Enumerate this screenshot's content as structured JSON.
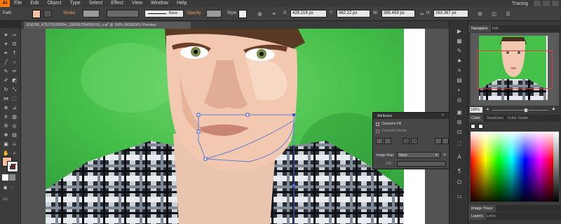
{
  "app": {
    "logo": "Ai",
    "menu": [
      "File",
      "Edit",
      "Object",
      "Type",
      "Select",
      "Effect",
      "View",
      "Window",
      "Help"
    ],
    "workspace": "Tracing"
  },
  "controlbar": {
    "selection_label": "Path",
    "stroke_label": "Stroke",
    "brush_value": "Basic",
    "opacity_label": "Opacity",
    "style_label": "Style",
    "x_value": "428.219 px",
    "y_value": "462.22 px",
    "w_value": "385.459 px",
    "h_value": "263.367 px",
    "fill_color": "#f4c1a5"
  },
  "document": {
    "tab_title": "1150706_4752723335554_1369587054055015_n.ai* @ 150% (RGB/GPU Preview)"
  },
  "navigator": {
    "tabs": [
      "Navigator",
      "Info"
    ],
    "zoom": "100%"
  },
  "attributes_panel": {
    "title": "Attributes",
    "overprint_fill": "Overprint Fill",
    "overprint_stroke": "Overprint Stroke",
    "image_map_label": "Image Map:",
    "image_map_value": "None",
    "url_label": "URL:"
  },
  "color_panel": {
    "tabs": [
      "Color",
      "Swatches",
      "Color Guide"
    ]
  },
  "image_trace_panel": {
    "title": "Image Trace"
  },
  "layers_panel": {
    "tabs": [
      "Layers",
      "Links"
    ]
  },
  "colors": {
    "skin": "#f0c6ad",
    "background_green": "#3fbf47",
    "accent_orange": "#ff7c00"
  }
}
